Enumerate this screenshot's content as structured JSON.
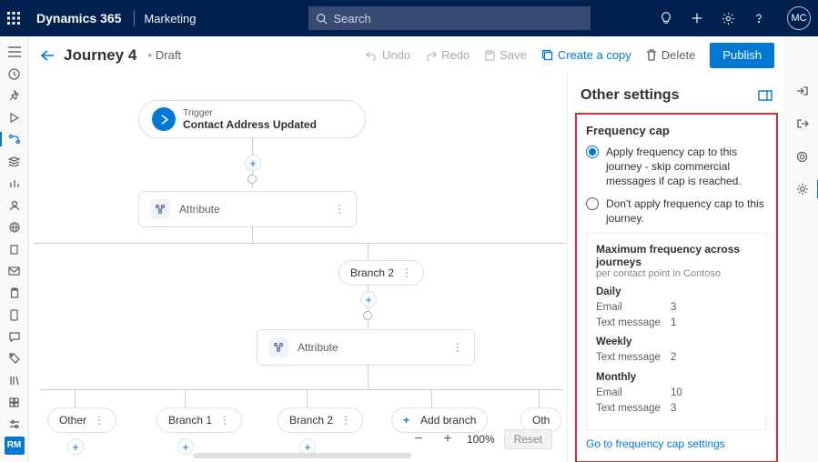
{
  "nav": {
    "brand": "Dynamics 365",
    "area": "Marketing",
    "search_placeholder": "Search",
    "avatar": "MC"
  },
  "page": {
    "title": "Journey 4",
    "status": "Draft"
  },
  "commands": {
    "undo": "Undo",
    "redo": "Redo",
    "save": "Save",
    "copy": "Create a copy",
    "delete": "Delete",
    "publish": "Publish"
  },
  "left_rm": "RM",
  "canvas": {
    "trigger_label": "Trigger",
    "trigger_value": "Contact Address Updated",
    "attribute": "Attribute",
    "branch2": "Branch 2",
    "branch1": "Branch 1",
    "add_branch": "Add branch",
    "other": "Other",
    "oth": "Oth"
  },
  "zoom": {
    "pct": "100%",
    "reset": "Reset"
  },
  "panel": {
    "title": "Other settings",
    "freq_title": "Frequency cap",
    "opt1": "Apply frequency cap to this journey - skip commercial messages if cap is reached.",
    "opt2": "Don't apply frequency cap to this journey.",
    "card_title": "Maximum frequency across journeys",
    "card_sub": "per contact point in Contoso",
    "daily": "Daily",
    "weekly": "Weekly",
    "monthly": "Monthly",
    "email": "Email",
    "text": "Text message",
    "v_daily_email": "3",
    "v_daily_text": "1",
    "v_weekly_text": "2",
    "v_monthly_email": "10",
    "v_monthly_text": "3",
    "link": "Go to frequency cap settings"
  }
}
